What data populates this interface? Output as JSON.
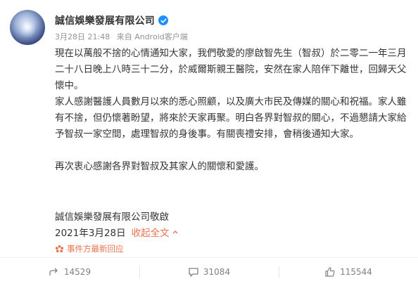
{
  "author": {
    "name": "誠信娛樂發展有限公司",
    "verified_icon": "verified-badge-icon"
  },
  "meta": {
    "timestamp": "3月28日 21:48",
    "source": "来自 Android客户端"
  },
  "content": {
    "paragraph_1": "現在以萬般不捨的心情通知大家，我們敬愛的廖啟智先生（智叔）於二零二一年三月二十八日晚上八時三十二分，於威爾斯親王醫院，安然在家人陪伴下離世，回歸天父懷中。",
    "paragraph_2": "家人感謝醫護人員數月以來的悉心照顧，以及廣大市民及傳媒的關心和祝福。家人雖有不捨，但仍懷著盼望，將來於天家再聚。明白各界對智叔的關心，不過懇請大家給予智叔一家空間，處理智叔的身後事。有關喪禮安排，會稍後通知大家。",
    "paragraph_3": "再次衷心感謝各界對智叔及其家人的關懷和愛護。",
    "signoff": "誠信娛樂發展有限公司敬啟",
    "date": "2021年3月28日",
    "collapse_label": "收起全文"
  },
  "event_response": {
    "label": "事件方最新回应",
    "icon": "event-flower-icon"
  },
  "actions": {
    "share_count": "14529",
    "comment_count": "31084",
    "like_count": "115544"
  },
  "colors": {
    "accent": "#eb7350",
    "verified": "#1e90ff",
    "meta_text": "#939393"
  }
}
